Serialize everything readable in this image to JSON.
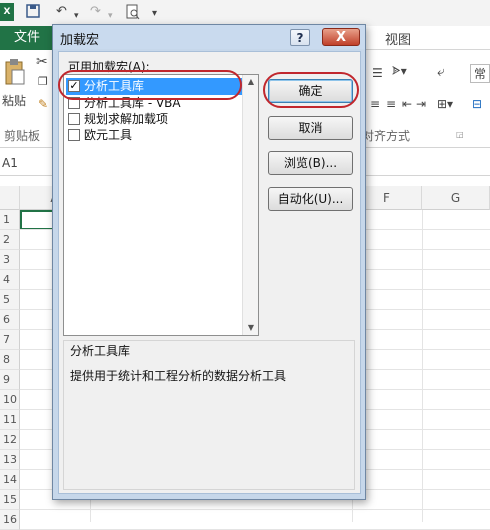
{
  "excel": {
    "logo": "X",
    "tabs": {
      "file": "文件",
      "view": "视图"
    },
    "ribbon": {
      "paste_label": "粘贴",
      "clipboard_group": "剪贴板",
      "alignment_group": "对齐方式",
      "number_format_partial": "常"
    },
    "name_box": "A1",
    "columns": [
      "A",
      "F",
      "G"
    ],
    "rows": [
      "1",
      "2",
      "3",
      "4",
      "5",
      "6",
      "7",
      "8",
      "9",
      "10",
      "11",
      "12",
      "13",
      "14",
      "15",
      "16"
    ]
  },
  "dialog": {
    "title": "加载宏",
    "help_glyph": "?",
    "close_glyph": "X",
    "available_label": "可用加载宏(A):",
    "addins": [
      {
        "label": "分析工具库",
        "checked": true,
        "selected": true
      },
      {
        "label": "分析工具库 - VBA",
        "checked": false,
        "selected": false
      },
      {
        "label": "规划求解加载项",
        "checked": false,
        "selected": false
      },
      {
        "label": "欧元工具",
        "checked": false,
        "selected": false
      }
    ],
    "buttons": {
      "ok": "确定",
      "cancel": "取消",
      "browse": "浏览(B)...",
      "automation": "自动化(U)..."
    },
    "description": {
      "title": "分析工具库",
      "text": "提供用于统计和工程分析的数据分析工具"
    }
  }
}
